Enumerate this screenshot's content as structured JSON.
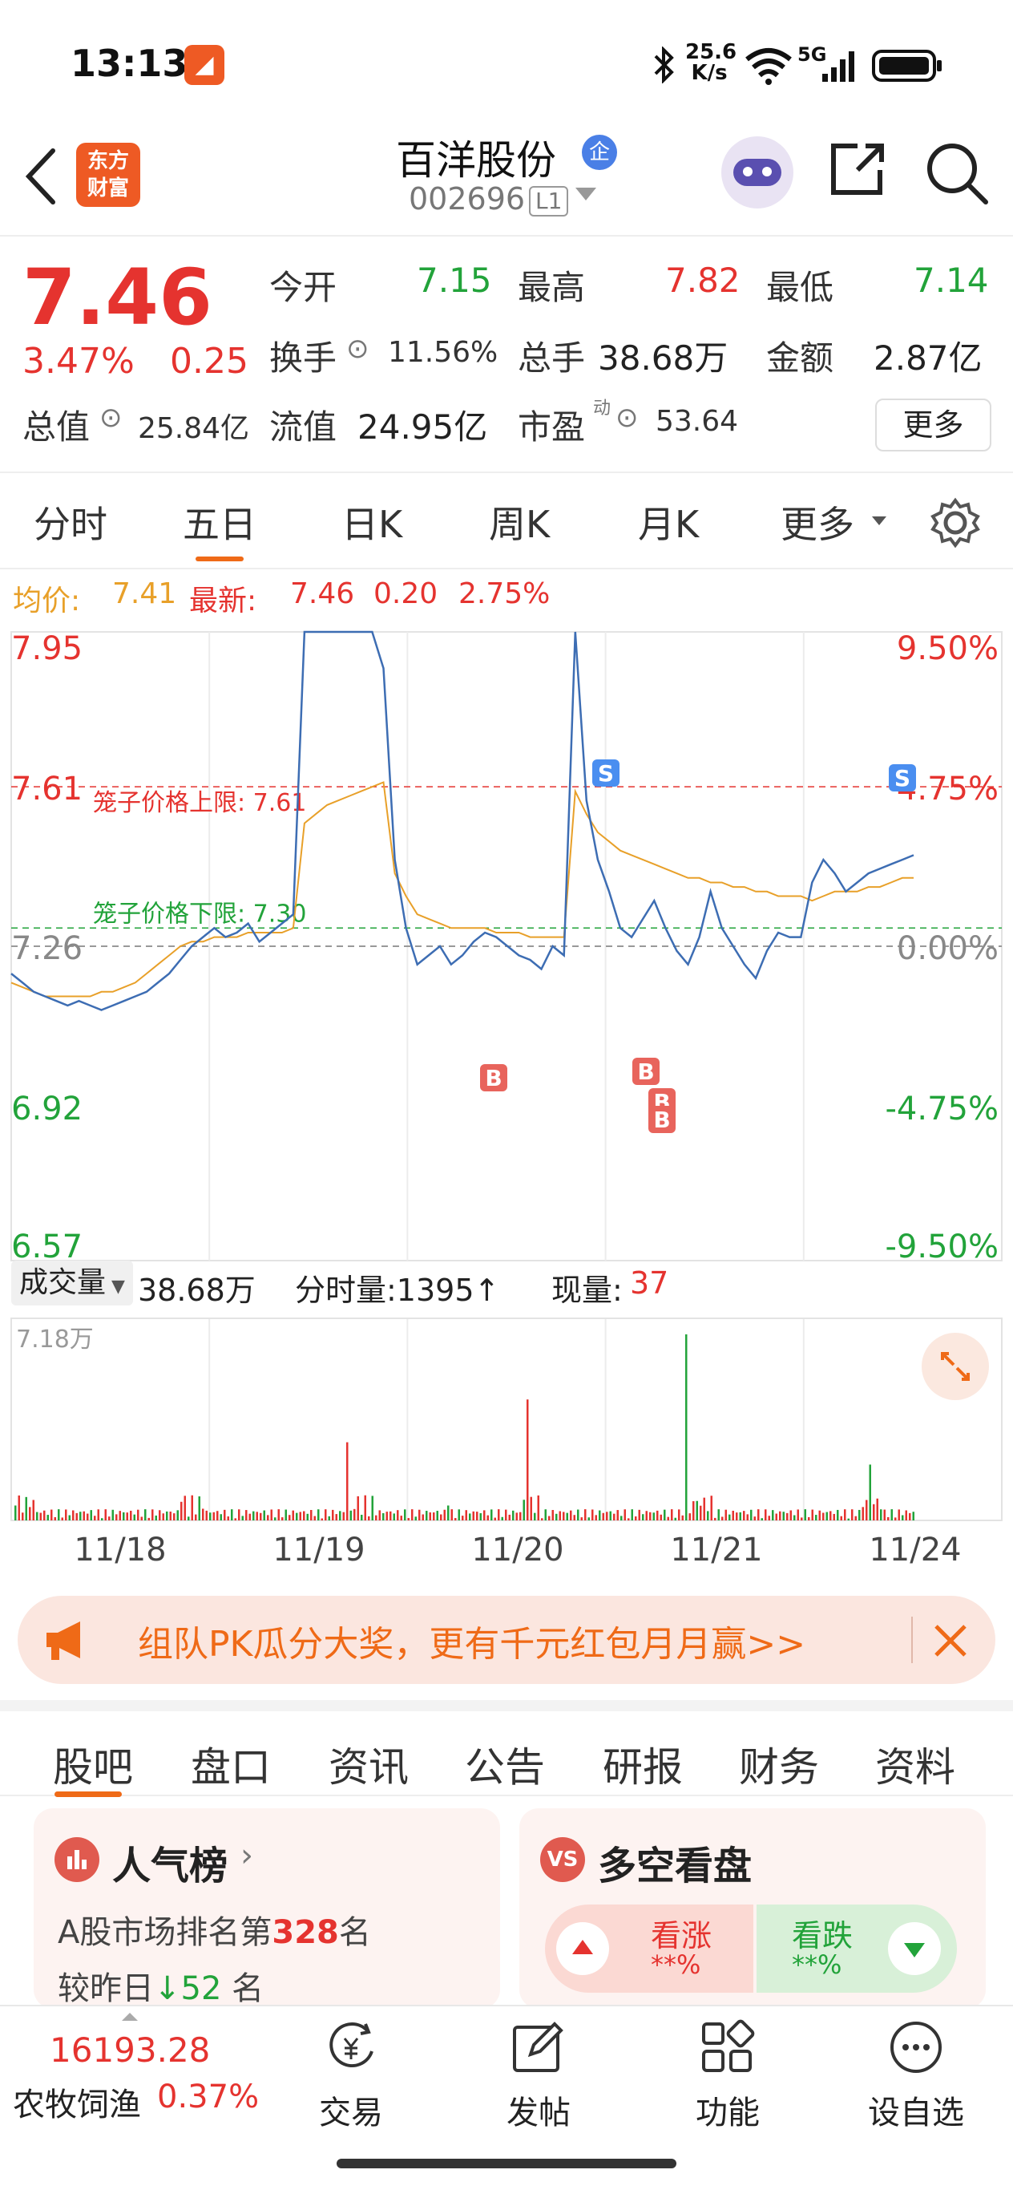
{
  "status": {
    "time": "13:13",
    "speed_value": "25.6",
    "speed_unit": "K/s",
    "network": "5G",
    "battery_icon": "battery-icon",
    "wifi_icon": "wifi-icon",
    "bluetooth_icon": "bluetooth-icon"
  },
  "header": {
    "back_icon": "back-icon",
    "logo_line1": "东方",
    "logo_line2": "财富",
    "stock_name": "百洋股份",
    "badge": "企",
    "stock_code": "002696",
    "level": "L1",
    "share_icon": "share-icon",
    "search_icon": "search-icon"
  },
  "quote": {
    "price": "7.46",
    "change_pct": "3.47%",
    "change_amt": "0.25",
    "open_label": "今开",
    "open_value": "7.15",
    "high_label": "最高",
    "high_value": "7.82",
    "low_label": "最低",
    "low_value": "7.14",
    "turnover_label": "换手",
    "turnover_value": "11.56%",
    "volume_label": "总手",
    "volume_value": "38.68万",
    "amount_label": "金额",
    "amount_value": "2.87亿",
    "mktcap_label": "总值",
    "mktcap_value": "25.84亿",
    "float_label": "流值",
    "float_value": "24.95亿",
    "pe_label": "市盈",
    "pe_sup": "动",
    "pe_value": "53.64",
    "more_label": "更多"
  },
  "period_tabs": [
    {
      "label": "分时",
      "active": false
    },
    {
      "label": "五日",
      "active": true
    },
    {
      "label": "日K",
      "active": false
    },
    {
      "label": "周K",
      "active": false
    },
    {
      "label": "月K",
      "active": false
    },
    {
      "label": "更多",
      "active": false
    }
  ],
  "chart_legend": {
    "avg_label": "均价:",
    "avg_value": "7.41",
    "latest_label": "最新:",
    "latest_value": "7.46",
    "latest_change": "0.20",
    "latest_pct": "2.75%"
  },
  "chart_data": {
    "type": "line",
    "price_axis": [
      "7.95",
      "7.61",
      "7.26",
      "6.92",
      "6.57"
    ],
    "pct_axis": [
      "9.50%",
      "4.75%",
      "0.00%",
      "-4.75%",
      "-9.50%"
    ],
    "ylim": [
      6.57,
      7.95
    ],
    "upper_limit_label": "笼子价格上限: 7.61",
    "lower_limit_label": "笼子价格下限: 7.30",
    "upper_limit": 7.61,
    "lower_limit": 7.3,
    "reference": 7.26,
    "x_labels": [
      "11/18",
      "11/19",
      "11/20",
      "11/21",
      "11/24"
    ],
    "markers": [
      "S",
      "S",
      "B",
      "B",
      "B",
      "B"
    ],
    "series": [
      {
        "name": "price",
        "values": [
          7.2,
          7.18,
          7.16,
          7.15,
          7.14,
          7.13,
          7.14,
          7.13,
          7.12,
          7.13,
          7.14,
          7.15,
          7.16,
          7.18,
          7.2,
          7.23,
          7.26,
          7.28,
          7.3,
          7.28,
          7.29,
          7.31,
          7.27,
          7.29,
          7.31,
          7.33,
          7.95,
          7.95,
          7.95,
          7.95,
          7.95,
          7.95,
          7.95,
          7.87,
          7.45,
          7.3,
          7.22,
          7.24,
          7.26,
          7.22,
          7.24,
          7.27,
          7.29,
          7.28,
          7.26,
          7.24,
          7.23,
          7.21,
          7.26,
          7.24,
          7.95,
          7.58,
          7.45,
          7.38,
          7.3,
          7.28,
          7.32,
          7.36,
          7.3,
          7.25,
          7.22,
          7.28,
          7.38,
          7.3,
          7.26,
          7.22,
          7.19,
          7.25,
          7.29,
          7.28,
          7.28,
          7.4,
          7.45,
          7.42,
          7.38,
          7.4,
          7.42,
          7.43,
          7.44,
          7.45,
          7.46
        ]
      },
      {
        "name": "avg",
        "values": [
          7.18,
          7.17,
          7.16,
          7.15,
          7.15,
          7.15,
          7.15,
          7.15,
          7.16,
          7.16,
          7.17,
          7.18,
          7.2,
          7.22,
          7.24,
          7.26,
          7.27,
          7.27,
          7.28,
          7.28,
          7.28,
          7.29,
          7.29,
          7.29,
          7.29,
          7.3,
          7.53,
          7.55,
          7.57,
          7.58,
          7.59,
          7.6,
          7.61,
          7.62,
          7.42,
          7.37,
          7.33,
          7.32,
          7.31,
          7.3,
          7.3,
          7.3,
          7.3,
          7.29,
          7.29,
          7.29,
          7.28,
          7.28,
          7.28,
          7.28,
          7.6,
          7.55,
          7.51,
          7.49,
          7.47,
          7.46,
          7.45,
          7.44,
          7.43,
          7.42,
          7.41,
          7.41,
          7.4,
          7.4,
          7.39,
          7.39,
          7.38,
          7.38,
          7.37,
          7.37,
          7.37,
          7.36,
          7.37,
          7.38,
          7.38,
          7.38,
          7.39,
          7.39,
          7.4,
          7.41,
          7.41
        ]
      }
    ]
  },
  "volume": {
    "label": "成交量",
    "total": "38.68万",
    "tick_label": "分时量:1395↑",
    "now_label": "现量:",
    "now_value": "37",
    "max_label": "7.18万"
  },
  "banner": {
    "text": "组队PK瓜分大奖，更有千元红包月月赢>>"
  },
  "info_tabs": [
    {
      "label": "股吧",
      "active": true
    },
    {
      "label": "盘口",
      "active": false
    },
    {
      "label": "资讯",
      "active": false
    },
    {
      "label": "公告",
      "active": false
    },
    {
      "label": "研报",
      "active": false
    },
    {
      "label": "财务",
      "active": false
    },
    {
      "label": "资料",
      "active": false
    }
  ],
  "popularity_card": {
    "title": "人气榜",
    "rank_prefix": "A股市场排名第",
    "rank_value": "328",
    "rank_suffix": "名",
    "change_prefix": "较昨日",
    "change_value": "52",
    "change_suffix": "名"
  },
  "sentiment_card": {
    "badge": "VS",
    "title": "多空看盘",
    "bull_label": "看涨",
    "bull_value": "**%",
    "bear_label": "看跌",
    "bear_value": "**%"
  },
  "bottom_nav": {
    "index_value": "16193.28",
    "index_name": "农牧饲渔",
    "index_change": "0.37%",
    "trade_label": "交易",
    "post_label": "发帖",
    "function_label": "功能",
    "watchlist_label": "设自选"
  }
}
